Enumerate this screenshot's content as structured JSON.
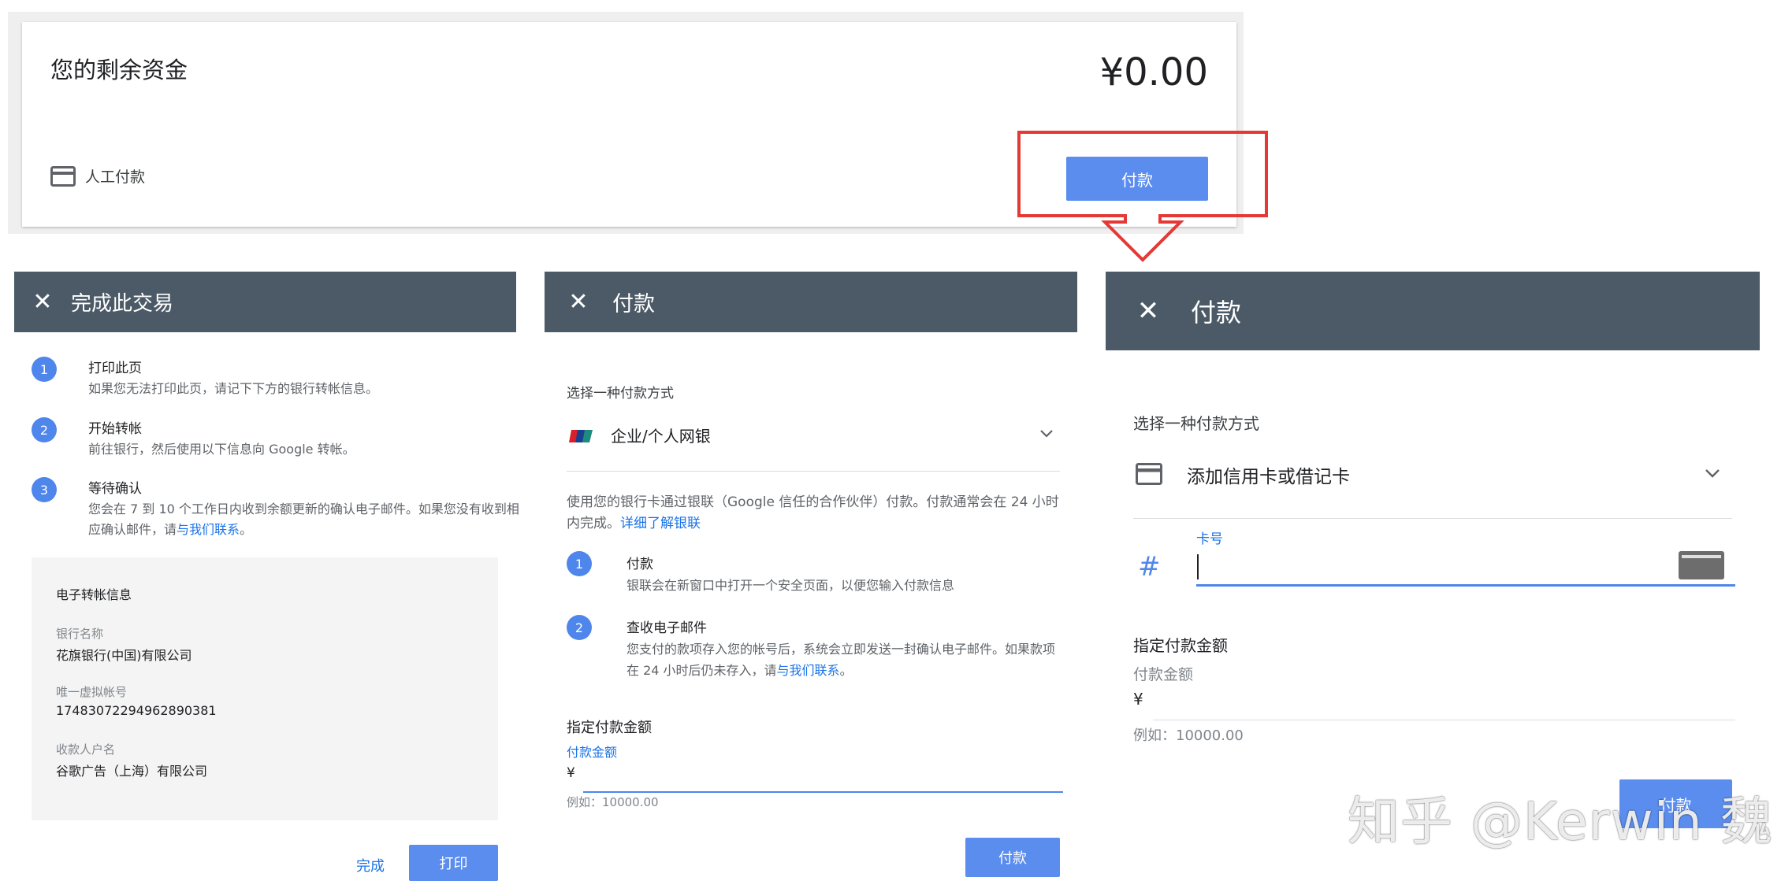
{
  "balance_card": {
    "title": "您的剩余资金",
    "amount": "¥0.00",
    "manual_payment": "人工付款",
    "pay_button": "付款"
  },
  "dialog_complete": {
    "title": "完成此交易",
    "steps": [
      {
        "num": "1",
        "title": "打印此页",
        "desc": "如果您无法打印此页，请记下下方的银行转帐信息。"
      },
      {
        "num": "2",
        "title": "开始转帐",
        "desc": "前往银行，然后使用以下信息向 Google 转帐。"
      },
      {
        "num": "3",
        "title": "等待确认",
        "desc": "您会在 7 到 10 个工作日内收到余额更新的确认电子邮件。如果您没有收到相应确认邮件，请",
        "link": "与我们联系",
        "suffix": "。"
      }
    ],
    "transfer_info": {
      "heading": "电子转帐信息",
      "bank_label": "银行名称",
      "bank_value": "花旗银行(中国)有限公司",
      "account_label": "唯一虚拟帐号",
      "account_value": "17483072294962890381",
      "payee_label": "收款人户名",
      "payee_value": "谷歌广告（上海）有限公司"
    },
    "done_button": "完成",
    "print_button": "打印"
  },
  "dialog_pay_bank": {
    "title": "付款",
    "choose_label": "选择一种付款方式",
    "selected_method": "企业/个人网银",
    "description": "使用您的银行卡通过银联（Google 信任的合作伙伴）付款。付款通常会在 24 小时内完成。",
    "learn_more": "详细了解银联",
    "steps": [
      {
        "num": "1",
        "title": "付款",
        "desc": "银联会在新窗口中打开一个安全页面，以便您输入付款信息"
      },
      {
        "num": "2",
        "title": "查收电子邮件",
        "desc": "您支付的款项存入您的帐号后，系统会立即发送一封确认电子邮件。如果款项在 24 小时后仍未存入，请",
        "link": "与我们联系",
        "suffix": "。"
      }
    ],
    "amount_title": "指定付款金额",
    "amount_label": "付款金额",
    "currency": "¥",
    "amount_hint": "例如：10000.00",
    "pay_button": "付款"
  },
  "dialog_pay_card": {
    "title": "付款",
    "choose_label": "选择一种付款方式",
    "selected_method": "添加信用卡或借记卡",
    "card_number_label": "卡号",
    "card_hash": "#",
    "amount_title": "指定付款金额",
    "amount_label": "付款金额",
    "currency": "¥",
    "amount_hint": "例如：10000.00",
    "pay_button": "付款"
  },
  "watermark": "知乎 @Kerwin 魏",
  "colors": {
    "header": "#4b5a66",
    "primary": "#5b8def",
    "annotation": "#e53935"
  }
}
